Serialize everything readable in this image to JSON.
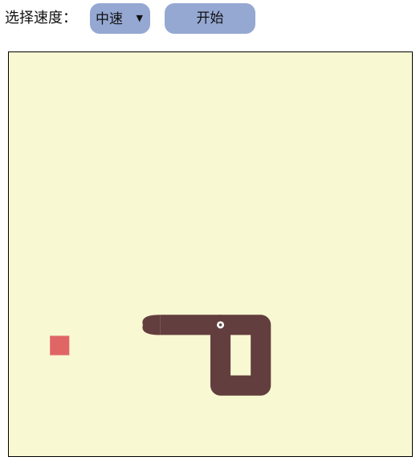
{
  "controls": {
    "speed_label": "选择速度：",
    "speed_selected": "中速",
    "start_label": "开始"
  },
  "game": {
    "grid_cells": 20,
    "snake": [
      [
        10,
        13
      ],
      [
        10,
        16
      ],
      [
        12,
        16
      ],
      [
        12,
        13
      ],
      [
        7,
        13
      ]
    ],
    "food": [
      2,
      14
    ],
    "colors": {
      "board": "#f8f8d2",
      "border": "#000000",
      "snake": "#633e3e",
      "food": "#e06666",
      "eye": "#ffffff"
    }
  }
}
